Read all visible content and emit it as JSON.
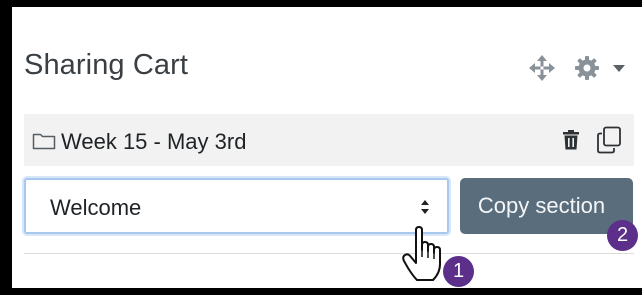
{
  "block": {
    "title": "Sharing Cart",
    "controls": {
      "move_icon": "move-arrows-icon",
      "settings_icon": "gear-icon",
      "menu_icon": "caret-down-icon"
    }
  },
  "section_item": {
    "label": "Week 15 - May 3rd",
    "folder_icon": "folder-icon",
    "delete_icon": "trash-icon",
    "copy_icon": "copy-icon"
  },
  "section_select": {
    "selected": "Welcome",
    "arrows_icon": "sort-arrows-icon"
  },
  "copy_button": {
    "label": "Copy section"
  },
  "annotations": {
    "step1": "1",
    "step2": "2",
    "badge_color": "#5b2f8a"
  },
  "colors": {
    "frame": "#000000",
    "button_bg": "#5a6d7c",
    "row_bg": "#f2f2f2",
    "select_focus_border": "#a9c8ee"
  }
}
